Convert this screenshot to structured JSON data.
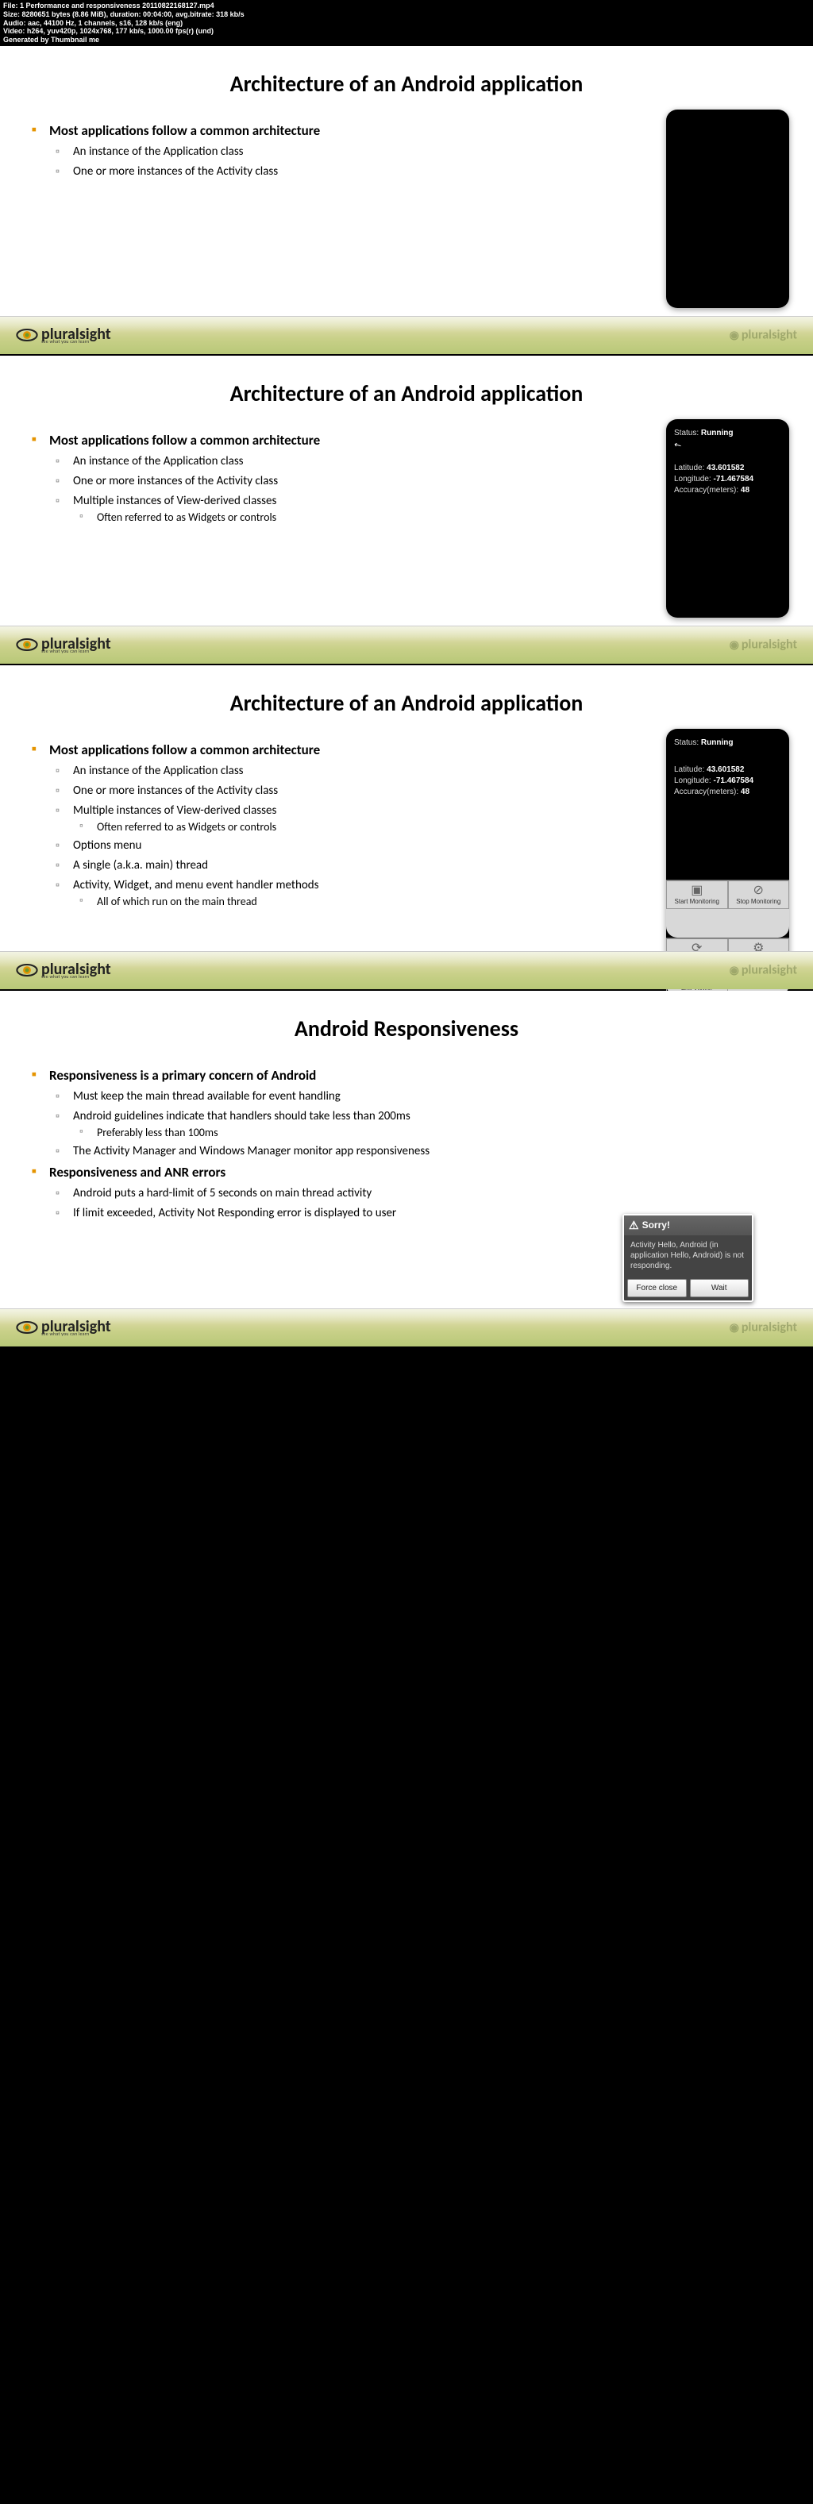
{
  "meta": {
    "file": "File: 1 Performance and responsiveness 20110822168127.mp4",
    "size": "Size: 8280651 bytes (8.86 MiB), duration: 00:04:00, avg.bitrate: 318 kb/s",
    "audio": "Audio: aac, 44100 Hz, 1 channels, s16, 128 kb/s (eng)",
    "video": "Video: h264, yuv420p, 1024x768, 177 kb/s, 1000.00 fps(r) (und)",
    "gen": "Generated by Thumbnail me"
  },
  "logo": {
    "brand": "pluralsight",
    "tag": "see what you can learn",
    "watermark": "pluralsight"
  },
  "slide1": {
    "title": "Architecture of an Android application",
    "b1": "Most applications follow a common architecture",
    "s1": "An instance of the Application class",
    "s2": "One or more instances of the Activity class"
  },
  "slide2": {
    "title": "Architecture of an Android application",
    "b1": "Most applications follow a common architecture",
    "s1": "An instance of the Application class",
    "s2": "One or more instances of the Activity class",
    "s3": "Multiple instances of View-derived classes",
    "s3a": "Often referred to as Widgets or controls",
    "phone": {
      "status_label": "Status: ",
      "status_val": "Running",
      "lat_label": "Latitude: ",
      "lat_val": "43.601582",
      "lon_label": "Longitude: ",
      "lon_val": "-71.467584",
      "acc_label": "Accuracy(meters): ",
      "acc_val": "48"
    }
  },
  "slide3": {
    "title": "Architecture of an Android application",
    "b1": "Most applications follow a common architecture",
    "s1": "An instance of the Application class",
    "s2": "One or more instances of the Activity class",
    "s3": "Multiple instances of View-derived classes",
    "s3a": "Often referred to as Widgets or controls",
    "s4": "Options menu",
    "s5": "A single (a.k.a. main) thread",
    "s6": "Activity, Widget, and menu event handler methods",
    "s6a": "All of which run on the main thread",
    "phone": {
      "status_label": "Status: ",
      "status_val": "Running",
      "lat_label": "Latitude: ",
      "lat_val": "43.601582",
      "lon_label": "Longitude: ",
      "lon_val": "-71.467584",
      "acc_label": "Accuracy(meters): ",
      "acc_val": "48",
      "m1": "Start Monitoring",
      "m2": "Stop Monitoring",
      "m3": "Refresh Display",
      "m4": "Preferences",
      "m5": "Exit Viewer"
    }
  },
  "slide4": {
    "title": "Android Responsiveness",
    "b1": "Responsiveness is a primary concern of Android",
    "s1": "Must keep the main thread available for event handling",
    "s2": "Android guidelines indicate that handlers should take less than 200ms",
    "s2a": "Preferably less than 100ms",
    "s3": "The Activity Manager and Windows Manager monitor app responsiveness",
    "b2": "Responsiveness and ANR errors",
    "s4": "Android puts a hard-limit of 5 seconds on main thread activity",
    "s5": "If limit exceeded, Activity Not Responding error is displayed to user",
    "anr": {
      "title": "Sorry!",
      "body": "Activity Hello, Android (in application Hello, Android) is not responding.",
      "btn1": "Force close",
      "btn2": "Wait"
    }
  }
}
